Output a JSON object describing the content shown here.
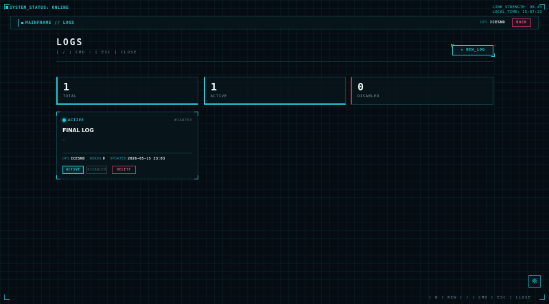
{
  "system": {
    "status_label": "SYSTEM_STATUS: ONLINE",
    "link_strength": "LINK_STRENGTH: 98.4%",
    "local_time": "LOCAL_TIME: 15:07:23"
  },
  "nav": {
    "breadcrumb": "MAINFRAME // LOGS",
    "operator_key": "OPS",
    "operator_value": "ICESND",
    "back_label": "BACK"
  },
  "header": {
    "title": "LOGS",
    "hint": "[ / ] CMD · [ ESC ] CLOSE",
    "new_button": "+ NEW_LOG"
  },
  "stats": [
    {
      "value": "1",
      "label": "TOTAL"
    },
    {
      "value": "1",
      "label": "ACTIVE"
    },
    {
      "value": "0",
      "label": "DISABLED"
    }
  ],
  "cards": [
    {
      "status": "ACTIVE",
      "id": "#1A8763",
      "title": "FINAL LOG",
      "body": "—",
      "ops_key": "OPS",
      "ops_value": "ICESND",
      "words_key": "WORDS",
      "words_value": "0",
      "updated_key": "UPDATED",
      "updated_value": "2026-05-15 23:03",
      "btn_active": "ACTIVE",
      "btn_disabled": "DISABLED",
      "btn_delete": "DELETE"
    }
  ],
  "footer": {
    "hint": "[ N ] NEW  [ / ] CMD  [ ESC ] CLOSE",
    "fab_icon": "❈"
  },
  "colors": {
    "accent": "#27c6d2",
    "danger": "#b8325c",
    "background": "#050d12"
  }
}
